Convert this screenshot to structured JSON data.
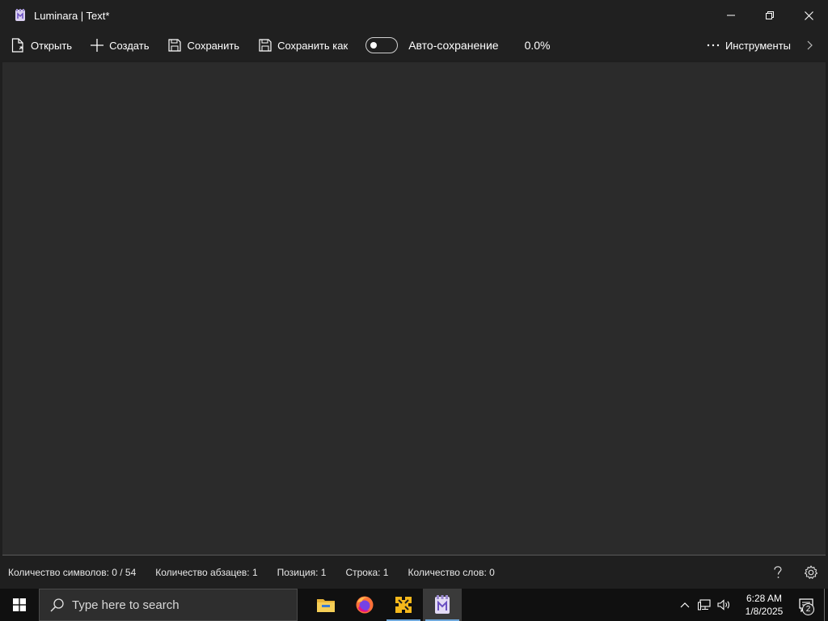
{
  "window": {
    "title": "Luminara | Text*"
  },
  "toolbar": {
    "open_label": "Открыть",
    "create_label": "Создать",
    "save_label": "Сохранить",
    "save_as_label": "Сохранить как",
    "autosave_label": "Авто-сохранение",
    "autosave_on": false,
    "progress_text": "0.0%",
    "tools_label": "Инструменты"
  },
  "editor": {
    "text": ""
  },
  "status": {
    "chars": "Количество символов: 0 / 54",
    "paragraphs": "Количество абзацев: 1",
    "position": "Позиция: 1",
    "line": "Строка: 1",
    "words": "Количество слов: 0"
  },
  "taskbar": {
    "search_placeholder": "Type here to search",
    "apps": [
      {
        "name": "file-explorer-icon",
        "running": false
      },
      {
        "name": "firefox-icon",
        "running": false
      },
      {
        "name": "puzzle-app-icon",
        "running": true
      },
      {
        "name": "luminara-icon",
        "running": true,
        "active": true
      }
    ],
    "time": "6:28 AM",
    "date": "1/8/2025",
    "notification_count": "2"
  },
  "colors": {
    "chrome_bg": "#202020",
    "editor_bg": "#2b2b2b",
    "taskbar_bg": "#101010",
    "accent": "#6fa8dc"
  }
}
